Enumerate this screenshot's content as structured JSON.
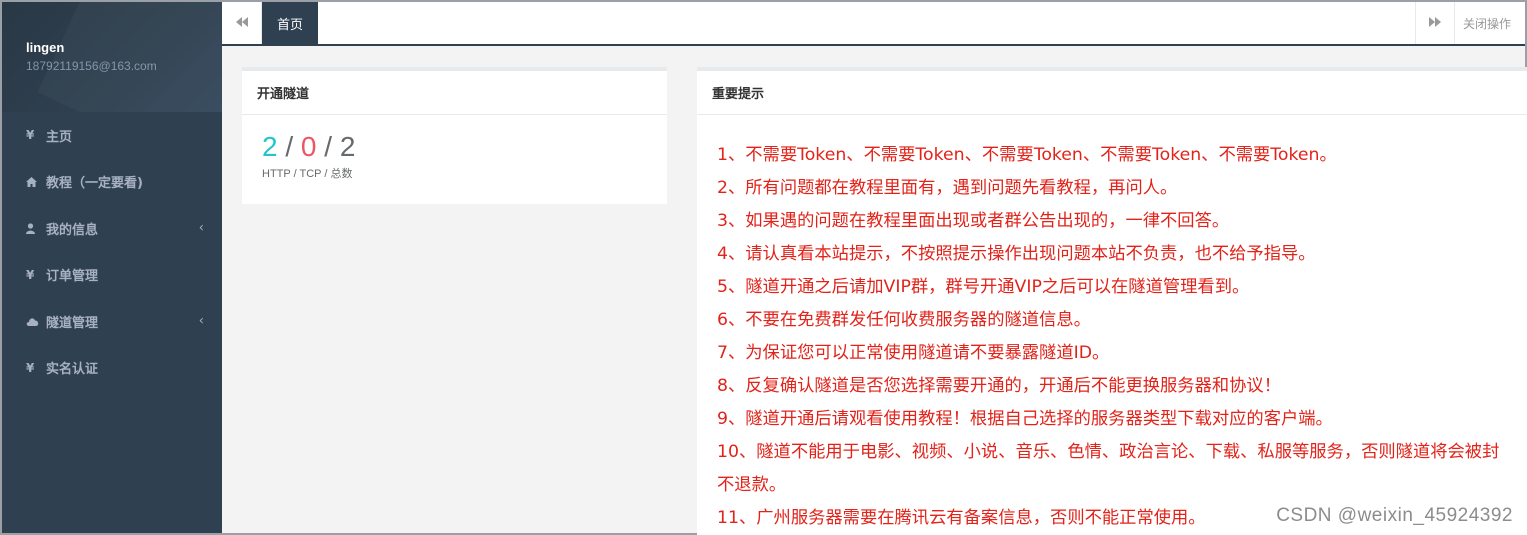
{
  "sidebar": {
    "profile": {
      "name": "lingen",
      "email": "18792119156@163.com"
    },
    "items": [
      {
        "icon": "yen-icon",
        "glyph": "¥",
        "label": "主页",
        "has_arrow": false
      },
      {
        "icon": "home-icon",
        "glyph": "",
        "label": "教程（一定要看)",
        "has_arrow": false
      },
      {
        "icon": "user-icon",
        "glyph": "",
        "label": "我的信息",
        "has_arrow": true
      },
      {
        "icon": "yen-icon",
        "glyph": "¥",
        "label": "订单管理",
        "has_arrow": false
      },
      {
        "icon": "cloud-icon",
        "glyph": "",
        "label": "隧道管理",
        "has_arrow": true
      },
      {
        "icon": "yen-icon",
        "glyph": "¥",
        "label": "实名认证",
        "has_arrow": false
      }
    ],
    "arrow_glyph": "‹"
  },
  "topbar": {
    "left_glyph": "◀◀",
    "tab_label": "首页",
    "right_glyph": "▶▶",
    "close_label": "关闭操作"
  },
  "tunnel_panel": {
    "title": "开通隧道",
    "http": "2",
    "tcp": "0",
    "total": "2",
    "sep": "/",
    "subtitle": "HTTP / TCP / 总数"
  },
  "notice_panel": {
    "title": "重要提示",
    "lines": [
      "1、不需要Token、不需要Token、不需要Token、不需要Token、不需要Token。",
      "2、所有问题都在教程里面有，遇到问题先看教程，再问人。",
      "3、如果遇的问题在教程里面出现或者群公告出现的，一律不回答。",
      "4、请认真看本站提示，不按照提示操作出现问题本站不负责，也不给予指导。",
      "5、隧道开通之后请加VIP群，群号开通VIP之后可以在隧道管理看到。",
      "6、不要在免费群发任何收费服务器的隧道信息。",
      "7、为保证您可以正常使用隧道请不要暴露隧道ID。",
      "8、反复确认隧道是否您选择需要开通的，开通后不能更换服务器和协议！",
      "9、隧道开通后请观看使用教程！根据自己选择的服务器类型下载对应的客户端。",
      "10、隧道不能用于电影、视频、小说、音乐、色情、政治言论、下载、私服等服务，否则隧道将会被封",
      "不退款。",
      "11、广州服务器需要在腾讯云有备案信息，否则不能正常使用。"
    ]
  },
  "colors": {
    "sidebar_bg": "#2f4050",
    "http": "#23c6c8",
    "tcp": "#ed5565",
    "notice_text": "#e2231a"
  },
  "watermark": "CSDN @weixin_45924392"
}
